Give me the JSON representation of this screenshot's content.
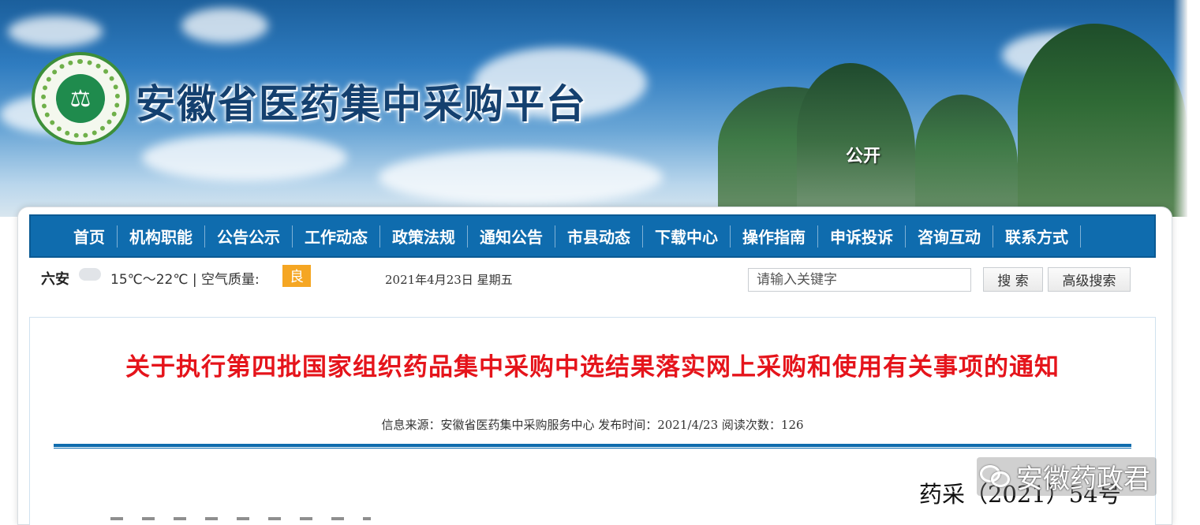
{
  "header": {
    "site_title": "安徽省医药集中采购平台",
    "tag": "公开"
  },
  "nav": {
    "items": [
      {
        "label": "首页"
      },
      {
        "label": "机构职能"
      },
      {
        "label": "公告公示"
      },
      {
        "label": "工作动态"
      },
      {
        "label": "政策法规"
      },
      {
        "label": "通知公告"
      },
      {
        "label": "市县动态"
      },
      {
        "label": "下载中心"
      },
      {
        "label": "操作指南"
      },
      {
        "label": "申诉投诉"
      },
      {
        "label": "咨询互动"
      },
      {
        "label": "联系方式"
      }
    ]
  },
  "infobar": {
    "city": "六安",
    "temperature": "15℃～22℃ | 空气质量:",
    "air_quality": "良",
    "air_quality_color": "#f5a623",
    "date": "2021年4月23日  星期五"
  },
  "search": {
    "placeholder": "请输入关键字",
    "search_button": "搜 索",
    "advanced_button": "高级搜索"
  },
  "article": {
    "title": "关于执行第四批国家组织药品集中采购中选结果落实网上采购和使用有关事项的通知",
    "meta": "信息来源：安徽省医药集中采购服务中心 发布时间：2021/4/23 阅读次数：126",
    "doc_number": "药采（2021）54号"
  },
  "watermark": {
    "text": "安徽药政君",
    "icon": "wechat-icon"
  },
  "colors": {
    "nav_bg": "#0f6cae",
    "title_red": "#e5141b",
    "site_title": "#14406f"
  }
}
